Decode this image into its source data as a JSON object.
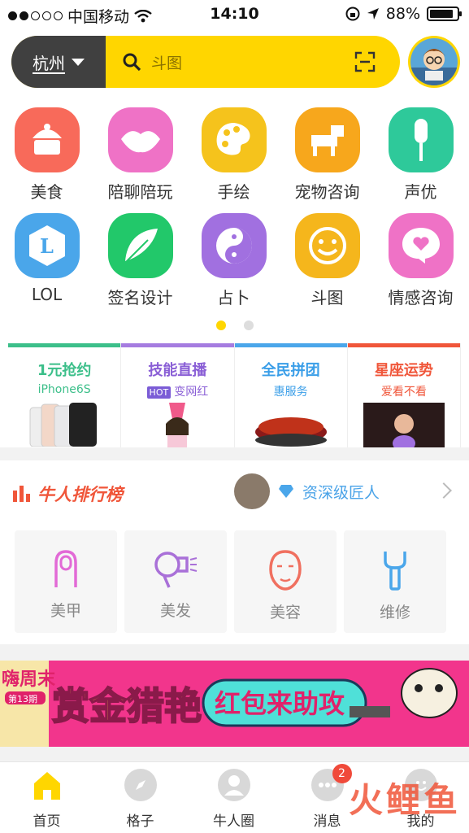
{
  "status": {
    "carrier": "中国移动",
    "time": "14:10",
    "battery": "88%",
    "battery_level": 0.88
  },
  "search": {
    "city": "杭州",
    "placeholder": "斗图"
  },
  "categories": [
    {
      "label": "美食",
      "color": "#f86a5a",
      "icon": "cake-icon"
    },
    {
      "label": "陪聊陪玩",
      "color": "#ef72c6",
      "icon": "lips-icon"
    },
    {
      "label": "手绘",
      "color": "#f5c31c",
      "icon": "palette-icon"
    },
    {
      "label": "宠物咨询",
      "color": "#f7a71c",
      "icon": "dog-icon"
    },
    {
      "label": "声优",
      "color": "#2ec99a",
      "icon": "microphone-icon"
    },
    {
      "label": "LOL",
      "color": "#4aa6ea",
      "icon": "lol-icon"
    },
    {
      "label": "签名设计",
      "color": "#22c86a",
      "icon": "feather-icon"
    },
    {
      "label": "占卜",
      "color": "#a170e0",
      "icon": "yinyang-icon"
    },
    {
      "label": "斗图",
      "color": "#f5b61c",
      "icon": "smiley-icon"
    },
    {
      "label": "情感咨询",
      "color": "#ef72c6",
      "icon": "heart-chat-icon"
    }
  ],
  "promos": [
    {
      "title": "1元抢约",
      "sub": "iPhone6S",
      "color": "#3cbf8a",
      "bar": "#3cbf8a"
    },
    {
      "title": "技能直播",
      "hot": "HOT",
      "sub": "变网红",
      "color": "#8a5fd6",
      "bar": "#a57ce0"
    },
    {
      "title": "全民拼团",
      "sub": "惠服务",
      "color": "#3a9ee8",
      "bar": "#4aa6ea"
    },
    {
      "title": "星座运势",
      "sub": "爱看不看",
      "color": "#f0563a",
      "bar": "#f0563a"
    }
  ],
  "rank": {
    "title": "牛人排行榜",
    "user_tag": "资深级匠人"
  },
  "skills": [
    {
      "label": "美甲",
      "color": "#e26ad6",
      "icon": "nail-icon"
    },
    {
      "label": "美发",
      "color": "#a970d8",
      "icon": "hairdryer-icon"
    },
    {
      "label": "美容",
      "color": "#f07060",
      "icon": "face-icon"
    },
    {
      "label": "维修",
      "color": "#4aa6ea",
      "icon": "wrench-icon"
    }
  ],
  "banner": {
    "left": "嗨周末",
    "issue": "第13期",
    "main": "赏金猎艳",
    "pill": "红包来助攻"
  },
  "tabs": [
    {
      "label": "首页",
      "icon": "home-icon"
    },
    {
      "label": "格子",
      "icon": "compass-icon"
    },
    {
      "label": "牛人圈",
      "icon": "people-icon"
    },
    {
      "label": "消息",
      "icon": "message-icon",
      "badge": "2"
    },
    {
      "label": "我的",
      "icon": "profile-icon"
    }
  ],
  "watermark": "火鲤鱼"
}
